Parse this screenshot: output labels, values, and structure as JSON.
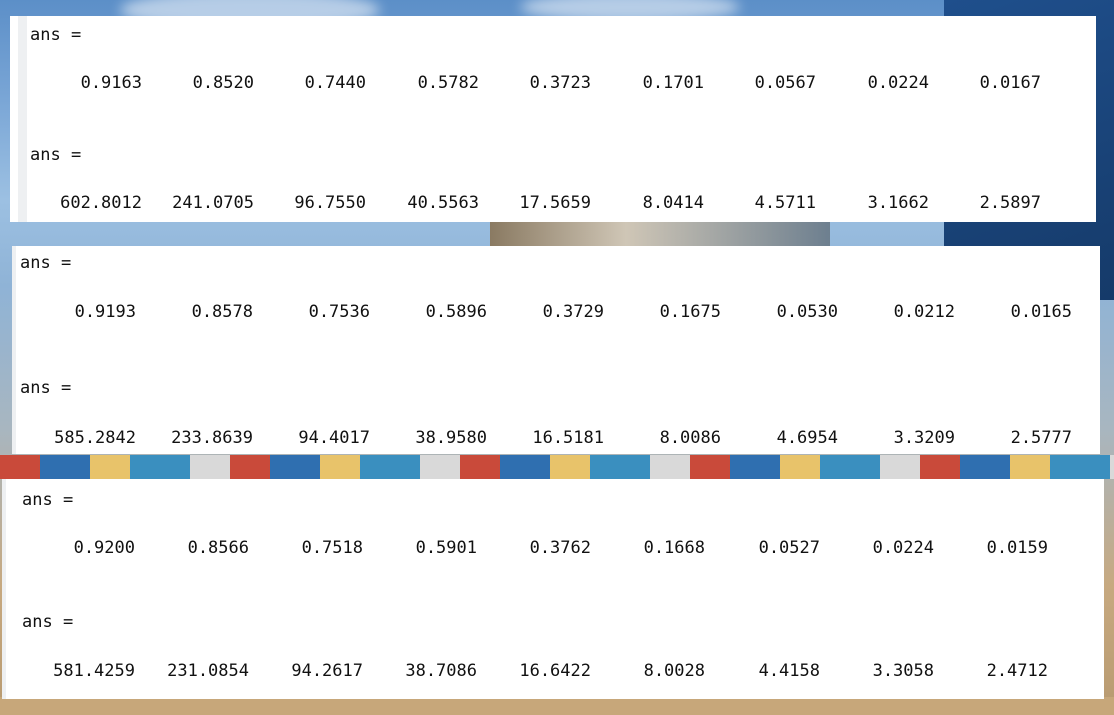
{
  "panels": [
    {
      "label1": "ans =",
      "row1": [
        "0.9163",
        "0.8520",
        "0.7440",
        "0.5782",
        "0.3723",
        "0.1701",
        "0.0567",
        "0.0224",
        "0.0167"
      ],
      "label2": "ans =",
      "row2": [
        "602.8012",
        "241.0705",
        "96.7550",
        "40.5563",
        "17.5659",
        "8.0414",
        "4.5711",
        "3.1662",
        "2.5897"
      ]
    },
    {
      "label1": "ans =",
      "row1": [
        "0.9193",
        "0.8578",
        "0.7536",
        "0.5896",
        "0.3729",
        "0.1675",
        "0.0530",
        "0.0212",
        "0.0165"
      ],
      "label2": "ans =",
      "row2": [
        "585.2842",
        "233.8639",
        "94.4017",
        "38.9580",
        "16.5181",
        "8.0086",
        "4.6954",
        "3.3209",
        "2.5777"
      ]
    },
    {
      "label1": "ans =",
      "row1": [
        "0.9200",
        "0.8566",
        "0.7518",
        "0.5901",
        "0.3762",
        "0.1668",
        "0.0527",
        "0.0224",
        "0.0159"
      ],
      "label2": "ans =",
      "row2": [
        "581.4259",
        "231.0854",
        "94.2617",
        "38.7086",
        "16.6422",
        "8.0028",
        "4.4158",
        "3.3058",
        "2.4712"
      ]
    }
  ]
}
